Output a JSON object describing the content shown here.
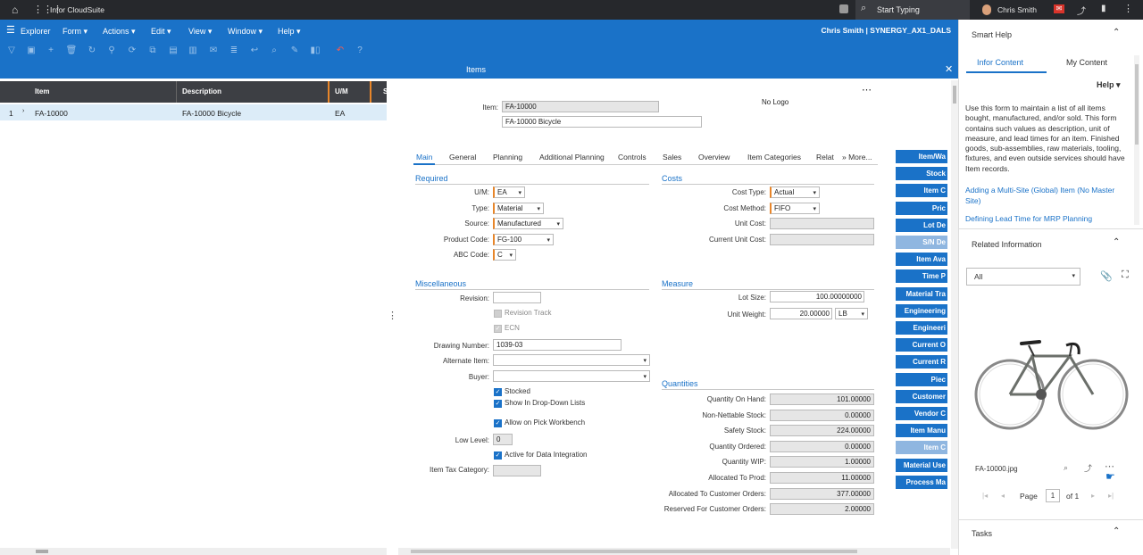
{
  "topbar": {
    "app_name": "Infor CloudSuite",
    "search_label": "Start Typing",
    "user_name": "Chris Smith"
  },
  "menubar": {
    "explorer": "Explorer",
    "menus": [
      "Form",
      "Actions",
      "Edit",
      "View",
      "Window",
      "Help"
    ],
    "session": "Chris Smith | SYNERGY_AX1_DALS"
  },
  "form_title": "Items",
  "grid": {
    "columns": [
      "Item",
      "Description",
      "U/M",
      "S"
    ],
    "rows": [
      {
        "num": "1",
        "item": "FA-10000",
        "description": "FA-10000 Bicycle",
        "um": "EA"
      }
    ]
  },
  "header": {
    "item_label": "Item:",
    "item_value": "FA-10000",
    "description_value": "FA-10000 Bicycle",
    "no_logo": "No Logo"
  },
  "tabs": [
    "Main",
    "General",
    "Planning",
    "Additional Planning",
    "Controls",
    "Sales",
    "Overview",
    "Item Categories",
    "Relat",
    "» More..."
  ],
  "required": {
    "title": "Required",
    "um_label": "U/M:",
    "um_value": "EA",
    "type_label": "Type:",
    "type_value": "Material",
    "source_label": "Source:",
    "source_value": "Manufactured",
    "product_code_label": "Product Code:",
    "product_code_value": "FG-100",
    "abc_label": "ABC Code:",
    "abc_value": "C"
  },
  "costs": {
    "title": "Costs",
    "cost_type_label": "Cost Type:",
    "cost_type_value": "Actual",
    "cost_method_label": "Cost Method:",
    "cost_method_value": "FIFO",
    "unit_cost_label": "Unit Cost:",
    "current_unit_cost_label": "Current Unit Cost:"
  },
  "misc": {
    "title": "Miscellaneous",
    "revision_label": "Revision:",
    "revision_track": "Revision Track",
    "ecn": "ECN",
    "drawing_label": "Drawing Number:",
    "drawing_value": "1039-03",
    "alternate_label": "Alternate Item:",
    "buyer_label": "Buyer:",
    "stocked": "Stocked",
    "show_dropdown": "Show In Drop-Down Lists",
    "allow_pick": "Allow on Pick Workbench",
    "low_level_label": "Low Level:",
    "low_level_value": "0",
    "active_integration": "Active for Data Integration",
    "tax_label": "Item Tax Category:"
  },
  "measure": {
    "title": "Measure",
    "lot_size_label": "Lot Size:",
    "lot_size_value": "100.00000000",
    "unit_weight_label": "Unit Weight:",
    "unit_weight_value": "20.00000",
    "unit_weight_um": "LB"
  },
  "quantities": {
    "title": "Quantities",
    "rows": [
      {
        "label": "Quantity On Hand:",
        "value": "101.00000"
      },
      {
        "label": "Non-Nettable Stock:",
        "value": "0.00000"
      },
      {
        "label": "Safety Stock:",
        "value": "224.00000"
      },
      {
        "label": "Quantity Ordered:",
        "value": "0.00000"
      },
      {
        "label": "Quantity WIP:",
        "value": "1.00000"
      },
      {
        "label": "Allocated To Prod:",
        "value": "11.00000"
      },
      {
        "label": "Allocated To Customer Orders:",
        "value": "377.00000"
      },
      {
        "label": "Reserved For Customer Orders:",
        "value": "2.00000"
      }
    ]
  },
  "right_buttons": [
    "Item/Wa",
    "Stock",
    "Item C",
    "Pric",
    "Lot De",
    "S/N De",
    "Item Ava",
    "Time P",
    "Material Tra",
    "Engineering",
    "Engineeri",
    "Current O",
    "Current R",
    "Piec",
    "Customer",
    "Vendor C",
    "Item Manu",
    "Item C",
    "Material Use",
    "Process Ma"
  ],
  "smart_help": {
    "title": "Smart Help",
    "tab_infor": "Infor Content",
    "tab_my": "My Content",
    "help_label": "Help",
    "text": "Use this form to maintain a list of all items bought, manufactured, and/or sold. This form contains such values as description, unit of measure, and lead times for an item. Finished goods, sub-assemblies, raw materials, tooling, fixtures, and even outside services should have Item records.",
    "link1": "Adding a Multi-Site (Global) Item (No Master Site)",
    "link2": "Defining Lead Time for MRP Planning",
    "related_title": "Related Information",
    "filter_value": "All",
    "file_name": "FA-10000.jpg",
    "page_label": "Page",
    "page_value": "1",
    "page_of": "of 1",
    "tasks_title": "Tasks"
  },
  "colors": {
    "accent": "#1a72c8",
    "topbar": "#26282c",
    "required": "#e8862a"
  }
}
